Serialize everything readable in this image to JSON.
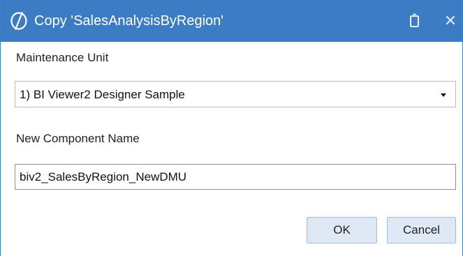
{
  "window": {
    "title": "Copy 'SalesAnalysisByRegion'",
    "icon": "app-logo-icon",
    "maximize_icon": "maximize-icon",
    "close_icon": "close-icon",
    "close_glyph": "✕",
    "titlebar_color": "#3b7cc4"
  },
  "form": {
    "maintenance_unit_label": "Maintenance Unit",
    "maintenance_unit_value": "1) BI Viewer2 Designer Sample",
    "new_component_name_label": "New Component Name",
    "new_component_name_value": "biv2_SalesByRegion_NewDMU"
  },
  "buttons": {
    "ok_label": "OK",
    "cancel_label": "Cancel",
    "button_color": "#dfe9f6"
  }
}
